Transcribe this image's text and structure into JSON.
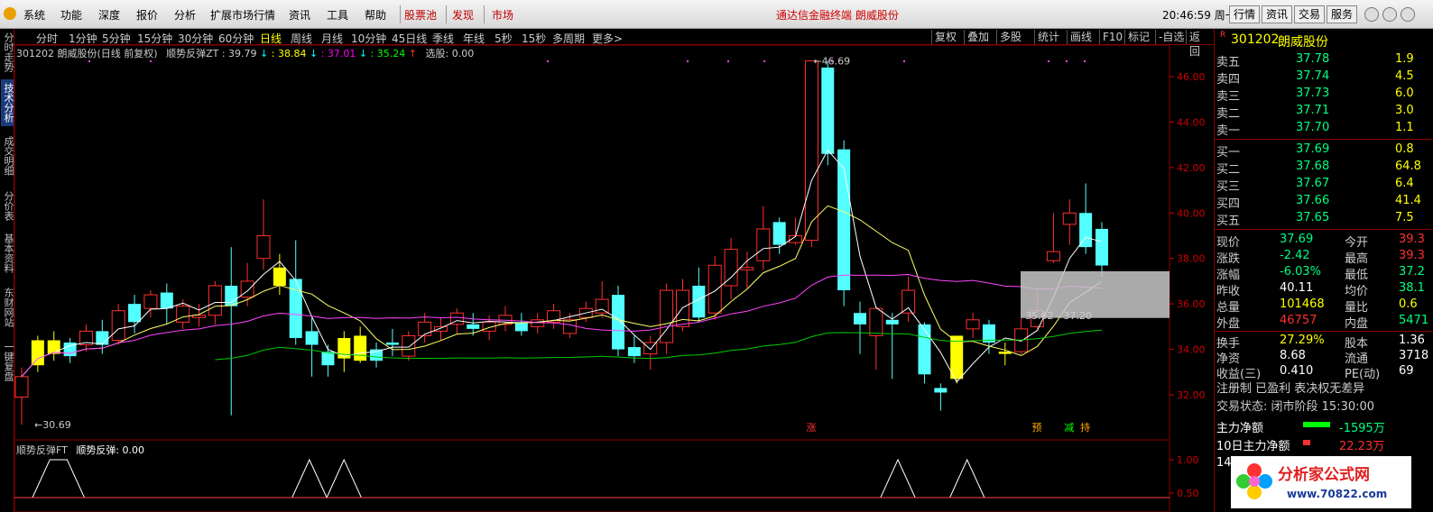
{
  "menu": [
    "系统",
    "功能",
    "深度",
    "报价",
    "分析",
    "扩展市场行情",
    "资讯",
    "工具",
    "帮助"
  ],
  "menu_red": [
    "股票池",
    "发现",
    "市场"
  ],
  "brand": "通达信金融终端  朗威股份",
  "clock": "20:46:59 周一",
  "top_buttons": [
    "行情",
    "资讯",
    "交易",
    "服务"
  ],
  "left_tabs": [
    {
      "label": "分时走势",
      "active": false
    },
    {
      "label": "技术分析",
      "active": true
    },
    {
      "label": "成交明细",
      "active": false
    },
    {
      "label": "分价表",
      "active": false
    },
    {
      "label": "基本资料",
      "active": false
    },
    {
      "label": "东财网站",
      "active": false
    },
    {
      "label": "一键复盘",
      "active": false
    }
  ],
  "periods": [
    "分时",
    "1分钟",
    "5分钟",
    "15分钟",
    "30分钟",
    "60分钟",
    "日线",
    "周线",
    "月线",
    "10分钟",
    "45日线",
    "季线",
    "年线",
    "5秒",
    "15秒",
    "多周期",
    "更多>"
  ],
  "active_period": "日线",
  "tools": [
    "复权",
    "叠加",
    "多股",
    "统计",
    "画线",
    "F10",
    "标记",
    "-自选",
    "返回"
  ],
  "info": {
    "stock": "301202 朗威股份(日线 前复权)",
    "indicator": "顺势反弹ZT : 39.79",
    "v2": ": 38.84",
    "v3": ": 37.01",
    "v4": ": 35.24",
    "v5": "选股: 0.00"
  },
  "sub_indicator": {
    "name": "顺势反弹FT",
    "label": "顺势反弹: 0.00"
  },
  "chart_data": {
    "type": "candlestick",
    "y_ticks": [
      "46.00",
      "44.00",
      "42.00",
      "40.00",
      "38.00",
      "36.00",
      "34.00",
      "32.00"
    ],
    "sub_y_ticks": [
      "1.00",
      "0.50"
    ],
    "annotations": {
      "high": "46.69",
      "low": "30.69",
      "range": "35.62 - 37.20"
    },
    "marks": [
      "涨",
      "预",
      "减",
      "持"
    ],
    "sub_signal": [
      0,
      1,
      1,
      0,
      0,
      0,
      0,
      0,
      0,
      0,
      0,
      0,
      0,
      0,
      0,
      0,
      1,
      0,
      1,
      0,
      0,
      0,
      0,
      0,
      0,
      0,
      0,
      0,
      0,
      0,
      0,
      0,
      0,
      0,
      0,
      0,
      0,
      0,
      0,
      0,
      0,
      0,
      0,
      0,
      0,
      0,
      0,
      0,
      0,
      0,
      1,
      0,
      0,
      0,
      1,
      0,
      0,
      0,
      0,
      0,
      0,
      0
    ]
  },
  "quote": {
    "code": "301202",
    "name": "朗威股份",
    "asks": [
      {
        "label": "卖五",
        "price": "37.78",
        "vol": "1.9"
      },
      {
        "label": "卖四",
        "price": "37.74",
        "vol": "4.5"
      },
      {
        "label": "卖三",
        "price": "37.73",
        "vol": "6.0"
      },
      {
        "label": "卖二",
        "price": "37.71",
        "vol": "3.0"
      },
      {
        "label": "卖一",
        "price": "37.70",
        "vol": "1.1"
      }
    ],
    "bids": [
      {
        "label": "买一",
        "price": "37.69",
        "vol": "0.8"
      },
      {
        "label": "买二",
        "price": "37.68",
        "vol": "64.8"
      },
      {
        "label": "买三",
        "price": "37.67",
        "vol": "6.4"
      },
      {
        "label": "买四",
        "price": "37.66",
        "vol": "41.4"
      },
      {
        "label": "买五",
        "price": "37.65",
        "vol": "7.5"
      }
    ],
    "stats": [
      {
        "l1": "现价",
        "v1": "37.69",
        "l2": "今开",
        "v2": "39.3"
      },
      {
        "l1": "涨跌",
        "v1": "-2.42",
        "l2": "最高",
        "v2": "39.3"
      },
      {
        "l1": "涨幅",
        "v1": "-6.03%",
        "l2": "最低",
        "v2": "37.2"
      },
      {
        "l1": "昨收",
        "v1": "40.11",
        "l2": "均价",
        "v2": "38.1"
      },
      {
        "l1": "总量",
        "v1": "101468",
        "l2": "量比",
        "v2": "0.6"
      },
      {
        "l1": "外盘",
        "v1": "46757",
        "l2": "内盘",
        "v2": "5471"
      }
    ],
    "stats2": [
      {
        "l1": "换手",
        "v1": "27.29%",
        "l2": "股本",
        "v2": "1.36"
      },
      {
        "l1": "净资",
        "v1": "8.68",
        "l2": "流通",
        "v2": "3718"
      },
      {
        "l1": "收益(三)",
        "v1": "0.410",
        "l2": "PE(动)",
        "v2": "69"
      }
    ],
    "reg": "注册制 已盈利 表决权无差异",
    "trade_state": "交易状态: 闭市阶段 15:30:00",
    "net_flow": {
      "label": "主力净额",
      "value": "-1595万"
    },
    "net_flow10": {
      "label": "10日主力净额",
      "value": "22.23万"
    },
    "bottom_num": "14"
  },
  "watermark": {
    "title": "分析家公式网",
    "url": "www.70822.com"
  }
}
